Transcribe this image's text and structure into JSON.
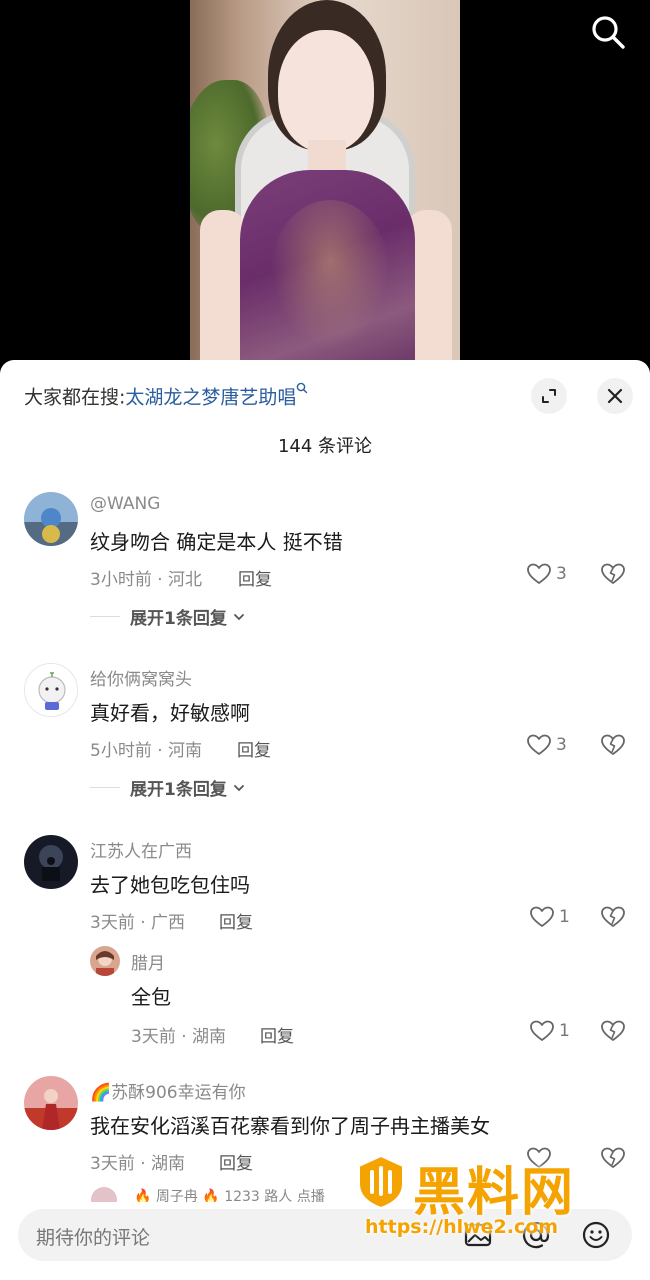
{
  "header": {
    "trending_prefix": "大家都在搜:",
    "trending_term": "太湖龙之梦唐艺助唱",
    "trending_icon": "search-small-icon"
  },
  "comment_count": "144 条评论",
  "comments": [
    {
      "username": "@WANG",
      "text": "纹身吻合 确定是本人 挺不错",
      "meta": "3小时前 · 河北",
      "reply_label": "回复",
      "likes": "3",
      "expand_label": "展开1条回复"
    },
    {
      "username": "给你俩窝窝头",
      "text": "真好看，好敏感啊",
      "meta": "5小时前 · 河南",
      "reply_label": "回复",
      "likes": "3",
      "expand_label": "展开1条回复"
    },
    {
      "username": "江苏人在广西",
      "text": "去了她包吃包住吗",
      "meta": "3天前 · 广西",
      "reply_label": "回复",
      "likes": "1",
      "replies": [
        {
          "username": "腊月",
          "text": "全包",
          "meta": "3天前 · 湖南",
          "reply_label": "回复",
          "likes": "1"
        }
      ]
    },
    {
      "username": "🌈苏酥906幸运有你",
      "text": "我在安化滔溪百花寨看到你了周子冉主播美女",
      "meta": "3天前 · 湖南",
      "reply_label": "回复"
    }
  ],
  "peek_text": "🔥 周子冉 🔥 1233 路人 点播",
  "input": {
    "placeholder": "期待你的评论"
  },
  "watermark": {
    "title": "黑料网",
    "url": "https://hlwe2.com"
  },
  "colors": {
    "link_blue": "#2a5d9e",
    "watermark_orange": "#f5a300",
    "muted_gray": "#8a8a8a"
  }
}
